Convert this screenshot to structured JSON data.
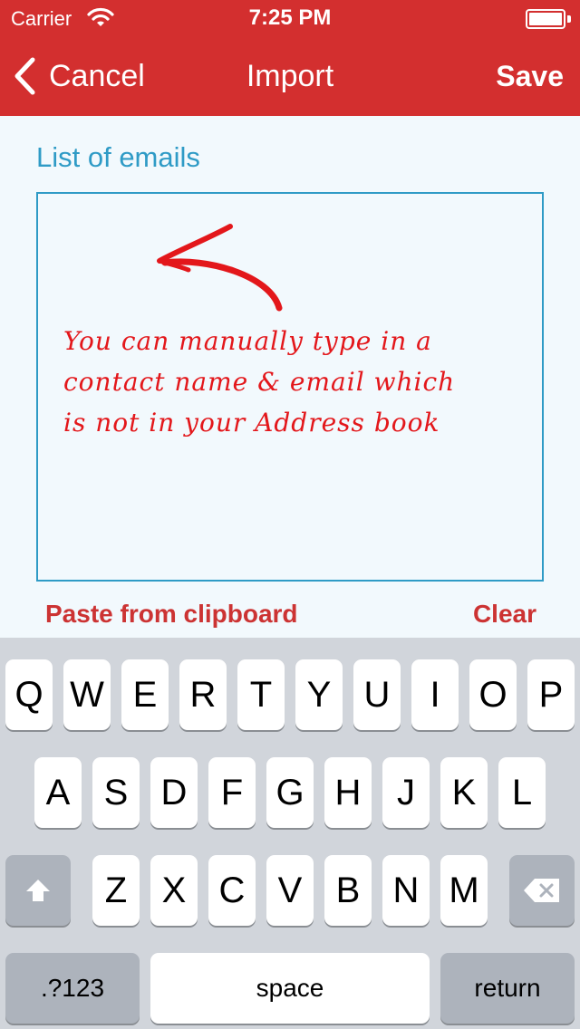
{
  "status_bar": {
    "carrier": "Carrier",
    "time": "7:25 PM"
  },
  "nav": {
    "back_label": "Cancel",
    "title": "Import",
    "save_label": "Save"
  },
  "form": {
    "section_label": "List of emails",
    "email_value": "",
    "annotation": [
      "You can manually type in a",
      "contact name & email which",
      "is not in your Address book"
    ]
  },
  "actions": {
    "paste_label": "Paste from clipboard",
    "clear_label": "Clear"
  },
  "keyboard": {
    "row1": [
      "Q",
      "W",
      "E",
      "R",
      "T",
      "Y",
      "U",
      "I",
      "O",
      "P"
    ],
    "row2": [
      "A",
      "S",
      "D",
      "F",
      "G",
      "H",
      "J",
      "K",
      "L"
    ],
    "row3": [
      "Z",
      "X",
      "C",
      "V",
      "B",
      "N",
      "M"
    ],
    "numbers_label": ".?123",
    "space_label": "space",
    "return_label": "return",
    "shift_icon": "shift-icon",
    "delete_icon": "backspace-icon"
  },
  "colors": {
    "header": "#d32f2f",
    "accent": "#2f9bc6",
    "action": "#cc3333",
    "annotation": "#e3171b"
  }
}
